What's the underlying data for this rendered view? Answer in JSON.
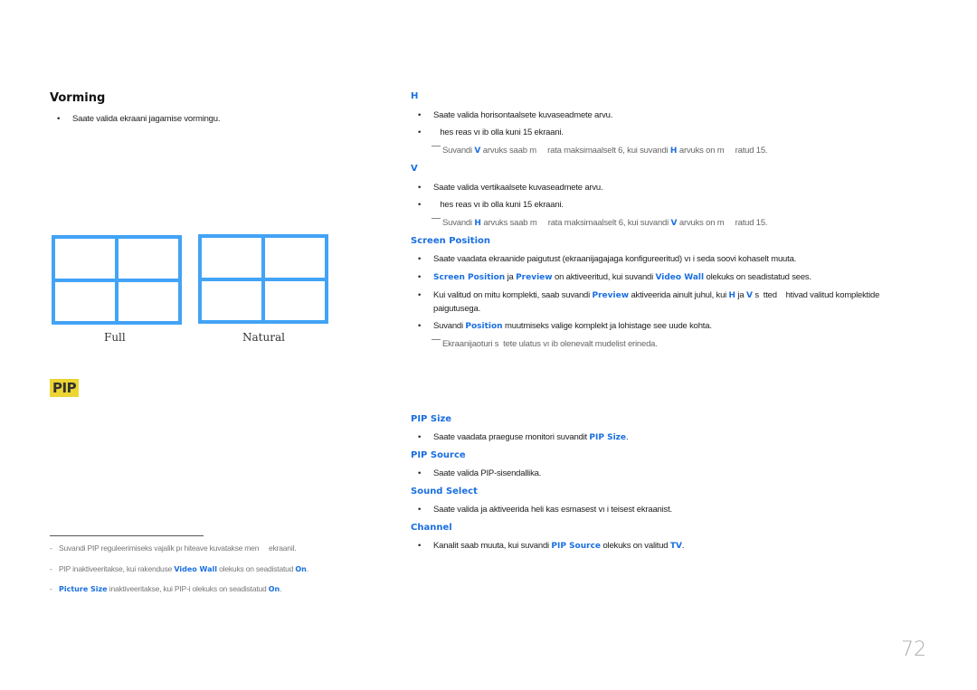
{
  "left": {
    "section_title": "Vorming",
    "bullet": "Saate valida ekraani jagamise vormingu.",
    "formats": [
      {
        "label": "Full"
      },
      {
        "label": "Natural"
      }
    ],
    "pip_badge": "PIP",
    "footnotes": [
      {
        "parts": [
          {
            "t": "Suvandi PIP reguleerimiseks vajalik pı hiteave kuvatakse men     ekraanil.",
            "h": false
          }
        ]
      },
      {
        "parts": [
          {
            "t": "PIP",
            "h": false
          },
          {
            "t": " inaktiveeritakse, kui rakenduse ",
            "h": false
          },
          {
            "t": "Video Wall",
            "h": true
          },
          {
            "t": " olekuks on seadistatud ",
            "h": false
          },
          {
            "t": "On",
            "h": true
          },
          {
            "t": ".",
            "h": false
          }
        ]
      },
      {
        "parts": [
          {
            "t": "Picture Size",
            "h": true
          },
          {
            "t": " inaktiveeritakse, kui PIP-i olekuks on seadistatud ",
            "h": false
          },
          {
            "t": "On",
            "h": true
          },
          {
            "t": ".",
            "h": false
          }
        ]
      }
    ]
  },
  "right": {
    "h": {
      "title": "H",
      "bullets": [
        "Saate valida horisontaalsete kuvaseadmete arvu.",
        "   hes reas vı ib olla kuni 15 ekraani."
      ],
      "note": {
        "pre": "Suvandi ",
        "k1": "V",
        "mid": " arvuks saab m     rata maksimaalselt 6, kui suvandi ",
        "k2": "H",
        "post": " arvuks on m     ratud 15."
      }
    },
    "v": {
      "title": "V",
      "bullets": [
        "Saate valida vertikaalsete kuvaseadmete arvu.",
        "   hes reas vı ib olla kuni 15 ekraani."
      ],
      "note": {
        "pre": "Suvandi ",
        "k1": "H",
        "mid": " arvuks saab m     rata maksimaalselt 6, kui suvandi ",
        "k2": "V",
        "post": " arvuks on m     ratud 15."
      }
    },
    "screen_position": {
      "title": "Screen Position",
      "b1": "Saate vaadata ekraanide paigutust (ekraanijagajaga konfigureeritud) vı i seda soovi kohaselt muuta.",
      "b2": {
        "k1": "Screen Position",
        "a": " ja ",
        "k2": "Preview",
        "b": " on aktiveeritud, kui suvandi ",
        "k3": "Video Wall",
        "c": " olekuks on seadistatud sees."
      },
      "b3": {
        "a": "Kui valitud on mitu komplekti, saab suvandi ",
        "k1": "Preview",
        "b": " aktiveerida ainult juhul, kui ",
        "k2": "H",
        "c": " ja ",
        "k3": "V",
        "d": " s  tted    htivad valitud komplektide",
        "line2": "paigutusega."
      },
      "b4": {
        "a": "Suvandi ",
        "k1": "Position",
        "b": " muutmiseks valige komplekt ja lohistage see uude kohta."
      },
      "note": "Ekraanijaoturi s  tete ulatus vı ib olenevalt mudelist erineda."
    },
    "pip_size": {
      "title": "PIP Size",
      "bullet": {
        "a": "Saate vaadata praeguse monitori suvandit ",
        "k1": "PIP Size",
        "b": "."
      }
    },
    "pip_source": {
      "title": "PIP Source",
      "bullet": "Saate valida PIP-sisendallika."
    },
    "sound_select": {
      "title": "Sound Select",
      "bullet": "Saate valida ja aktiveerida heli kas esmasest vı i teisest ekraanist."
    },
    "channel": {
      "title": "Channel",
      "bullet": {
        "a": "Kanalit saab muuta, kui suvandi ",
        "k1": "PIP Source",
        "b": " olekuks on valitud ",
        "k2": "TV",
        "c": "."
      }
    }
  },
  "bullet_char": "•",
  "footnote_char": "-",
  "page_number": "72",
  "colors": {
    "accent": "#1a6fe0",
    "grid": "#42a3f7",
    "badge": "#ecd533"
  }
}
